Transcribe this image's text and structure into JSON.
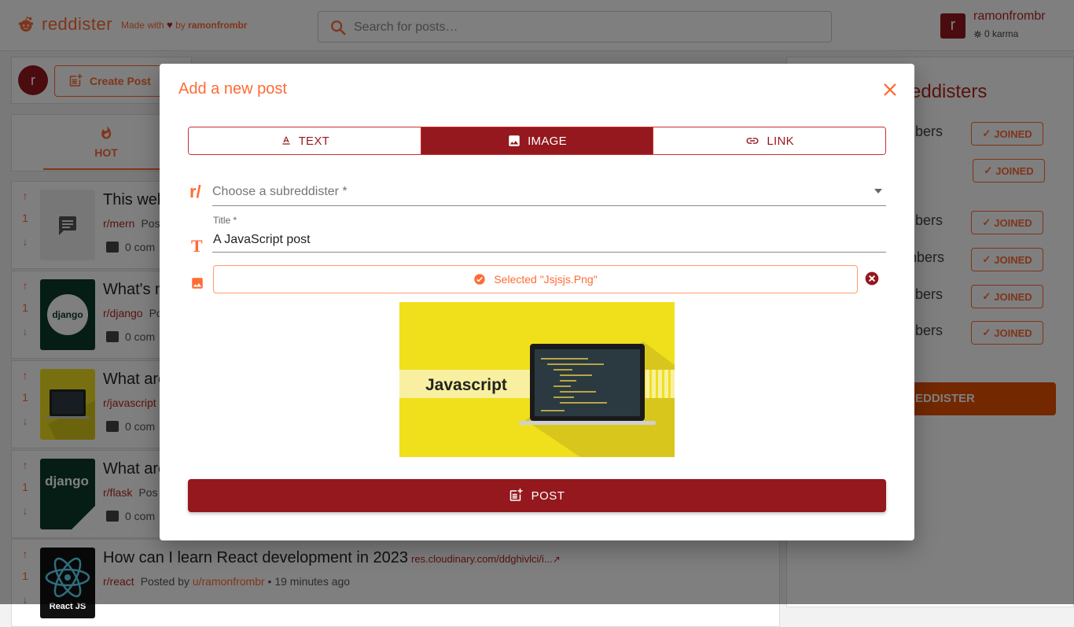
{
  "header": {
    "logo_text": "reddister",
    "made_with": "Made with",
    "by": "by",
    "author": "ramonfrombr",
    "search_placeholder": "Search for posts…",
    "user": {
      "avatar_letter": "r",
      "name": "ramonfrombr",
      "karma": "0 karma"
    }
  },
  "left": {
    "create_avatar_letter": "r",
    "create_post_label": "Create Post",
    "sort_tab_label": "HOT"
  },
  "posts": [
    {
      "votes": "1",
      "title": "This web",
      "subreddit": "r/mern",
      "posted": "Post",
      "comments": "0 com"
    },
    {
      "votes": "1",
      "title": "What's n",
      "subreddit": "r/django",
      "posted": "Po",
      "comments": "0 com",
      "thumb_text": "django"
    },
    {
      "votes": "1",
      "title": "What are",
      "subreddit": "r/javascript",
      "posted": "",
      "comments": "0 com"
    },
    {
      "votes": "1",
      "title": "What are",
      "subreddit": "r/flask",
      "posted": "Pos",
      "comments": "0 com",
      "thumb_text": "django"
    },
    {
      "votes": "1",
      "title": "How can I learn React development in 2023",
      "link": "res.cloudinary.com/ddghivlci/i...",
      "subreddit": "r/react",
      "posted": "Posted by",
      "user": "u/ramonfrombr",
      "time": "• 19 minutes ago",
      "thumb_text": "React JS"
    }
  ],
  "right": {
    "title": "reddisters",
    "joined_label": "JOINED",
    "member_texts": [
      "mbers",
      "",
      "mbers",
      "embers",
      "mbers",
      "mbers"
    ],
    "new_sub_label": "W SUBREDDISTER"
  },
  "modal": {
    "title": "Add a new post",
    "tabs": [
      {
        "label": "TEXT",
        "active": false
      },
      {
        "label": "IMAGE",
        "active": true
      },
      {
        "label": "LINK",
        "active": false
      }
    ],
    "subreddit_prefix": "r/",
    "subreddit_placeholder": "Choose a subreddister *",
    "title_label": "Title *",
    "title_value": "A JavaScript post",
    "selected_text": "Selected \"Jsjsjs.Png\"",
    "preview_caption": "Javascript",
    "post_button_label": "POST"
  },
  "colors": {
    "primary": "#94181d",
    "accent": "#ff6b35",
    "button_orange": "#e65100"
  }
}
